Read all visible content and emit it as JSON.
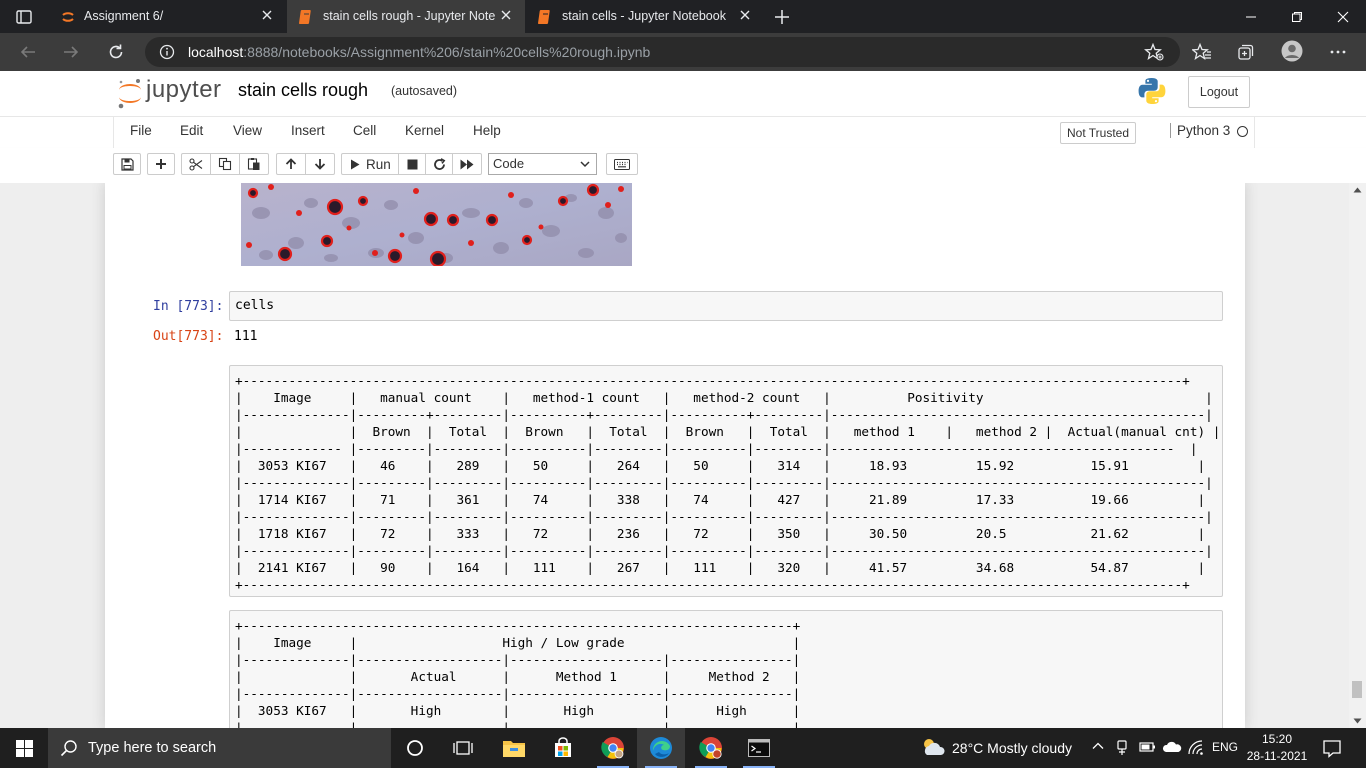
{
  "browser": {
    "tabs": [
      {
        "title": "Assignment 6/",
        "active": false
      },
      {
        "title": "stain cells rough - Jupyter Noteb",
        "active": true
      },
      {
        "title": "stain cells - Jupyter Notebook",
        "active": false
      }
    ],
    "url_host": "localhost",
    "url_path": ":8888/notebooks/Assignment%206/stain%20cells%20rough.ipynb"
  },
  "jupyter": {
    "logo_text": "jupyter",
    "notebook_name": "stain cells rough",
    "autosave": "(autosaved)",
    "logout_label": "Logout",
    "menu": [
      "File",
      "Edit",
      "View",
      "Insert",
      "Cell",
      "Kernel",
      "Help"
    ],
    "trust": "Not Trusted",
    "kernel": "Python 3",
    "run_label": "Run",
    "cell_type": "Code"
  },
  "cells": {
    "in_prompt": "In [773]:",
    "input_code": "cells",
    "out_prompt": "Out[773]:",
    "output_value": "111",
    "table1": "+---------------------------------------------------------------------------------------------------------------------------+\n|    Image     |   manual count    |   method-1 count   |   method-2 count   |          Positivity                             |\n|--------------|---------+---------|----------+---------|----------+---------|-------------------------------------------------|\n|              |  Brown  |  Total  |  Brown   |  Total  |  Brown   |  Total  |   method 1    |   method 2 |  Actual(manual cnt) |\n|------------- |---------|---------|----------|---------|----------|---------|---------------------------------------------  |\n|  3053 KI67   |   46    |   289   |   50     |   264   |   50     |   314   |     18.93         15.92          15.91         |\n|--------------|---------|---------|----------|---------|----------|---------|-------------------------------------------------|\n|  1714 KI67   |   71    |   361   |   74     |   338   |   74     |   427   |     21.89         17.33          19.66         |\n|--------------|---------|---------|----------|---------|----------|---------|-------------------------------------------------|\n|  1718 KI67   |   72    |   333   |   72     |   236   |   72     |   350   |     30.50         20.5           21.62         |\n|--------------|---------|---------|----------|---------|----------|---------|-------------------------------------------------|\n|  2141 KI67   |   90    |   164   |   111    |   267   |   111    |   320   |     41.57         34.68          54.87         |\n+---------------------------------------------------------------------------------------------------------------------------+",
    "table2": "+------------------------------------------------------------------------+\n|    Image     |                   High / Low grade                      |\n|--------------|-------------------|--------------------|----------------|\n|              |       Actual      |      Method 1      |     Method 2   |\n|--------------|-------------------|--------------------|----------------|\n|  3053 KI67   |       High        |       High         |      High      |\n|--------------|-------------------|--------------------|----------------|"
  },
  "taskbar": {
    "search_placeholder": "Type here to search",
    "weather": "28°C  Mostly cloudy",
    "language": "ENG",
    "time": "15:20",
    "date": "28-11-2021"
  },
  "colors": {
    "prompt_in": "#303f9f",
    "prompt_out": "#d84315",
    "jupyter_orange": "#f37726"
  }
}
